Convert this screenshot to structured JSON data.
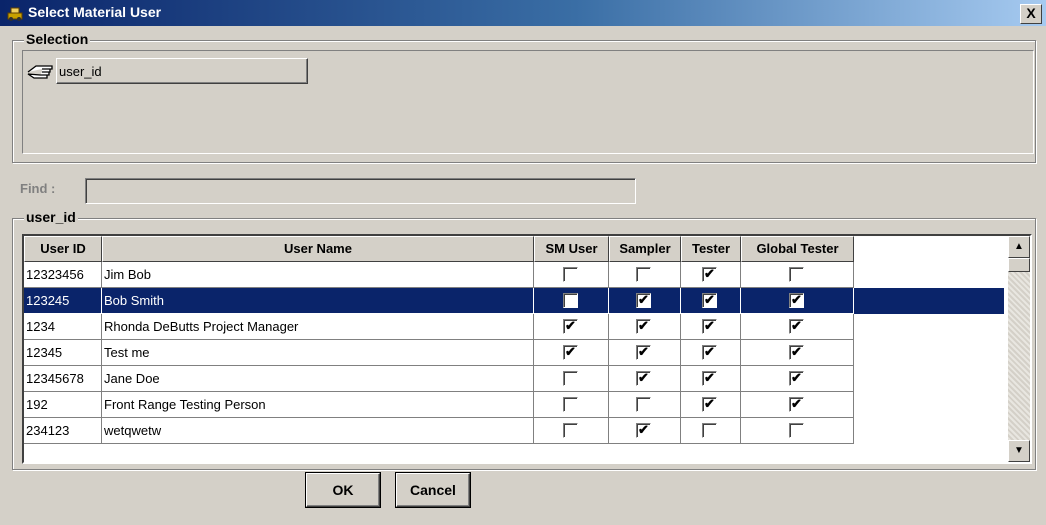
{
  "window": {
    "title": "Select Material User",
    "close_label": "X"
  },
  "selection": {
    "legend": "Selection",
    "chip_label": "user_id"
  },
  "find": {
    "label": "Find :",
    "value": ""
  },
  "grid": {
    "legend": "user_id",
    "columns": [
      "User ID",
      "User Name",
      "SM User",
      "Sampler",
      "Tester",
      "Global Tester"
    ],
    "rows": [
      {
        "id": "12323456",
        "name": "Jim Bob",
        "sm": false,
        "sampler": false,
        "tester": true,
        "global": false,
        "selected": false
      },
      {
        "id": "123245",
        "name": "Bob Smith",
        "sm": false,
        "sampler": true,
        "tester": true,
        "global": true,
        "selected": true
      },
      {
        "id": "1234",
        "name": "Rhonda DeButts Project Manager",
        "sm": true,
        "sampler": true,
        "tester": true,
        "global": true,
        "selected": false
      },
      {
        "id": "12345",
        "name": "Test me",
        "sm": true,
        "sampler": true,
        "tester": true,
        "global": true,
        "selected": false
      },
      {
        "id": "12345678",
        "name": "Jane Doe",
        "sm": false,
        "sampler": true,
        "tester": true,
        "global": true,
        "selected": false
      },
      {
        "id": "192",
        "name": "Front Range Testing Person",
        "sm": false,
        "sampler": false,
        "tester": true,
        "global": true,
        "selected": false
      },
      {
        "id": "234123",
        "name": "wetqwetw",
        "sm": false,
        "sampler": true,
        "tester": false,
        "global": false,
        "selected": false
      }
    ]
  },
  "buttons": {
    "ok": "OK",
    "cancel": "Cancel"
  },
  "colors": {
    "title_start": "#0a246a",
    "selection": "#0a246a",
    "face": "#d4d0c8"
  },
  "icons": [
    "app-icon",
    "hand-pointer-icon",
    "scroll-up-icon",
    "scroll-down-icon"
  ]
}
